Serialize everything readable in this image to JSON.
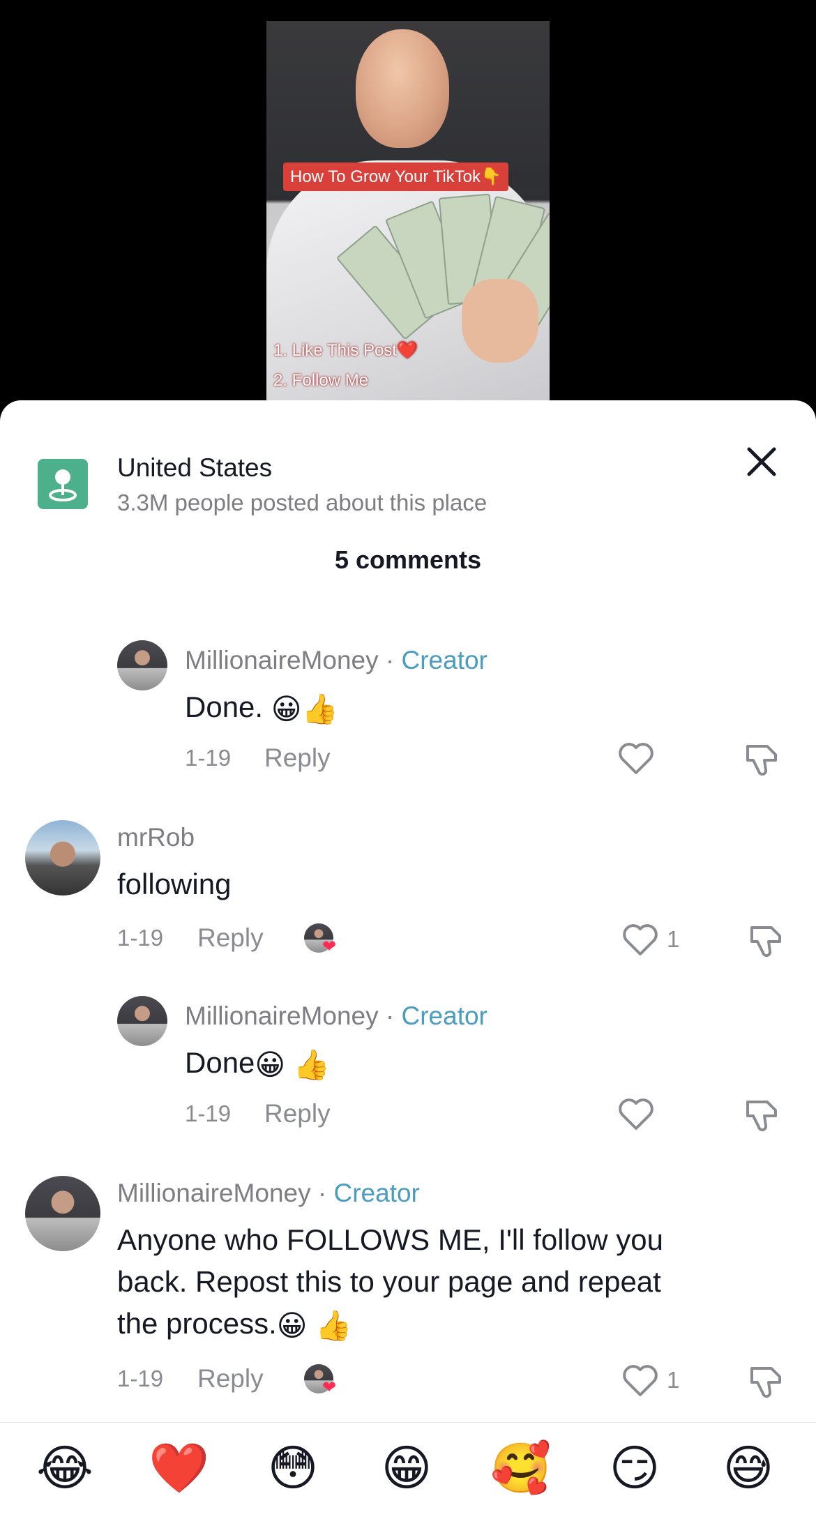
{
  "video": {
    "caption_title": "How To Grow Your TikTok👇",
    "caption_line1": "1. Like This Post❤️",
    "caption_line2": "2. Follow Me"
  },
  "place": {
    "title": "United States",
    "subtitle": "3.3M people posted about this place"
  },
  "comments_header": "5 comments",
  "comments": [
    {
      "author": "MillionaireMoney",
      "badge_sep": " · ",
      "badge": "Creator",
      "text": "Done.",
      "date": "1-19",
      "reply": "Reply"
    },
    {
      "author": "mrRob",
      "text": "following",
      "date": "1-19",
      "reply": "Reply",
      "likes": "1"
    },
    {
      "author": "MillionaireMoney",
      "badge_sep": " · ",
      "badge": "Creator",
      "text": "Done",
      "date": "1-19",
      "reply": "Reply"
    },
    {
      "author": "MillionaireMoney",
      "badge_sep": " · ",
      "badge": "Creator",
      "text_line1": "Anyone who FOLLOWS ME, I'll follow you",
      "text_line2": "back. Repost this to your page and repeat",
      "text_line3": "the process.",
      "date": "1-19",
      "reply": "Reply",
      "likes": "1"
    }
  ],
  "emoji_bar": [
    "😂",
    "❤️",
    "😳",
    "😁",
    "🥰",
    "😏",
    "😅"
  ],
  "icons": {
    "place": "location-pin-icon",
    "close": "close-icon",
    "like": "heart-outline-icon",
    "dislike": "thumbs-down-icon",
    "accent_creator": "#4a9cc2",
    "place_icon_bg": "#4db08c"
  }
}
